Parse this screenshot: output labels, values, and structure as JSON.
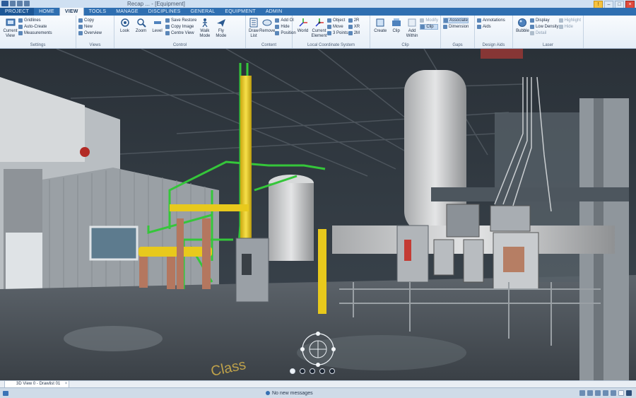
{
  "app": {
    "title": "Recap ... - [Equipment]"
  },
  "tabs": [
    "PROJECT",
    "HOME",
    "VIEW",
    "TOOLS",
    "MANAGE",
    "DISCIPLINES",
    "GENERAL",
    "EQUIPMENT",
    "ADMIN"
  ],
  "active_tab": "VIEW",
  "ribbon": {
    "settings": {
      "big": "Current View",
      "items": [
        "Gridlines",
        "Auto-Create",
        "Measurements"
      ],
      "label": "Settings"
    },
    "views": {
      "items": [
        "Copy",
        "New",
        "Overview"
      ],
      "label": "Views"
    },
    "control": {
      "big": [
        "Look",
        "Zoom",
        "Level",
        "Walk Mode",
        "Fly Mode"
      ],
      "items": [
        "Save Restore",
        "Copy Image",
        "Centre View"
      ],
      "label": "Control"
    },
    "content": {
      "big": [
        "Draw List",
        "Remove"
      ],
      "items": [
        "Add Ol",
        "Hide",
        "Position"
      ],
      "label": "Content"
    },
    "lcs": {
      "big": [
        "World",
        "Current Element"
      ],
      "items": [
        "Object",
        "Move",
        "3 Points",
        "2R",
        "XR",
        "2M"
      ],
      "label": "Local Coordinate System"
    },
    "clip": {
      "big": [
        "Create",
        "Clip",
        "Add Within"
      ],
      "items": [
        "Modify",
        "Clip"
      ],
      "label": "Clip"
    },
    "gaps": {
      "items": [
        "Associate",
        "Dimension"
      ],
      "label": "Gaps"
    },
    "design_aids": {
      "items": [
        "Annotations",
        "Aids"
      ],
      "label": "Design Aids"
    },
    "laser": {
      "big": [
        "Bubble"
      ],
      "items": [
        "Display",
        "Low Density",
        "Detail",
        "Highlight",
        "Hide"
      ],
      "label": "Laser"
    }
  },
  "viewport": {
    "floor_text": "Class"
  },
  "view_tab": {
    "label": "3D View 0 - Drawlist 01",
    "close": "×"
  },
  "status": {
    "message": "No new messages"
  },
  "colors": {
    "accent": "#2f6fb1",
    "pipe_green": "#35c63a",
    "pipe_yellow": "#e8c91c"
  }
}
